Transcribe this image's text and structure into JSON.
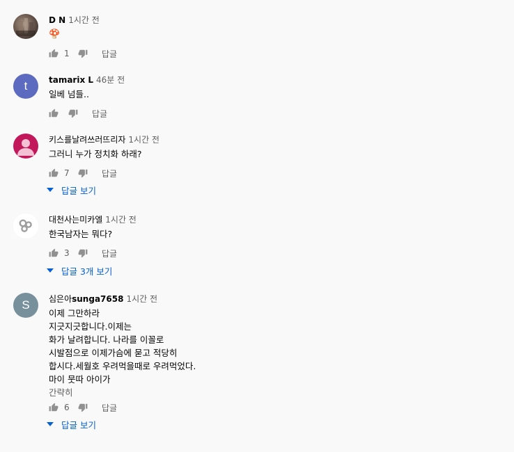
{
  "ui": {
    "reply_label": "답글",
    "icons": {
      "like": "thumbs-up-icon",
      "dislike": "thumbs-down-icon",
      "expand": "chevron-down-icon"
    },
    "colors": {
      "background": "#f9f9f9",
      "text": "#030303",
      "secondary_text": "#606060",
      "link_blue": "#065fd4"
    }
  },
  "comments": [
    {
      "author": "D N",
      "time": "1시간 전",
      "avatar_kind": "photo",
      "text_lines": [
        "🍄"
      ],
      "likes": "1"
    },
    {
      "author": "tamarix L",
      "time": "46분 전",
      "avatar_letter": "t",
      "avatar_color": "#5c6bc0",
      "text_lines": [
        "일베 넘들.."
      ],
      "likes": ""
    },
    {
      "author": "키스를날려쓰러뜨리자",
      "time": "1시간 전",
      "avatar_kind": "default-person",
      "avatar_color": "#c2185b",
      "text_lines": [
        "그러니 누가 정치화 하래?"
      ],
      "likes": "7",
      "view_replies": "답글 보기"
    },
    {
      "author": "대천사는미카엘",
      "time": "1시간 전",
      "avatar_kind": "circles",
      "text_lines": [
        "한국남자는 뭐다?"
      ],
      "likes": "3",
      "view_replies": "답글 3개 보기"
    },
    {
      "author": "심은아sunga7658",
      "time": "1시간 전",
      "avatar_letter": "S",
      "avatar_color": "#78909c",
      "text_lines": [
        "이제 그만하라",
        "지긋지긋합니다.이제는",
        "화가 날려합니다. 나라를 이꼴로",
        "시발점으로 이제가슴에 묻고 적당히",
        "합시다.세월호 우려먹을때로 우려먹었다.",
        "마이 뭇따 아이가"
      ],
      "read_more": "간략히",
      "likes": "6",
      "view_replies": "답글 보기"
    }
  ]
}
